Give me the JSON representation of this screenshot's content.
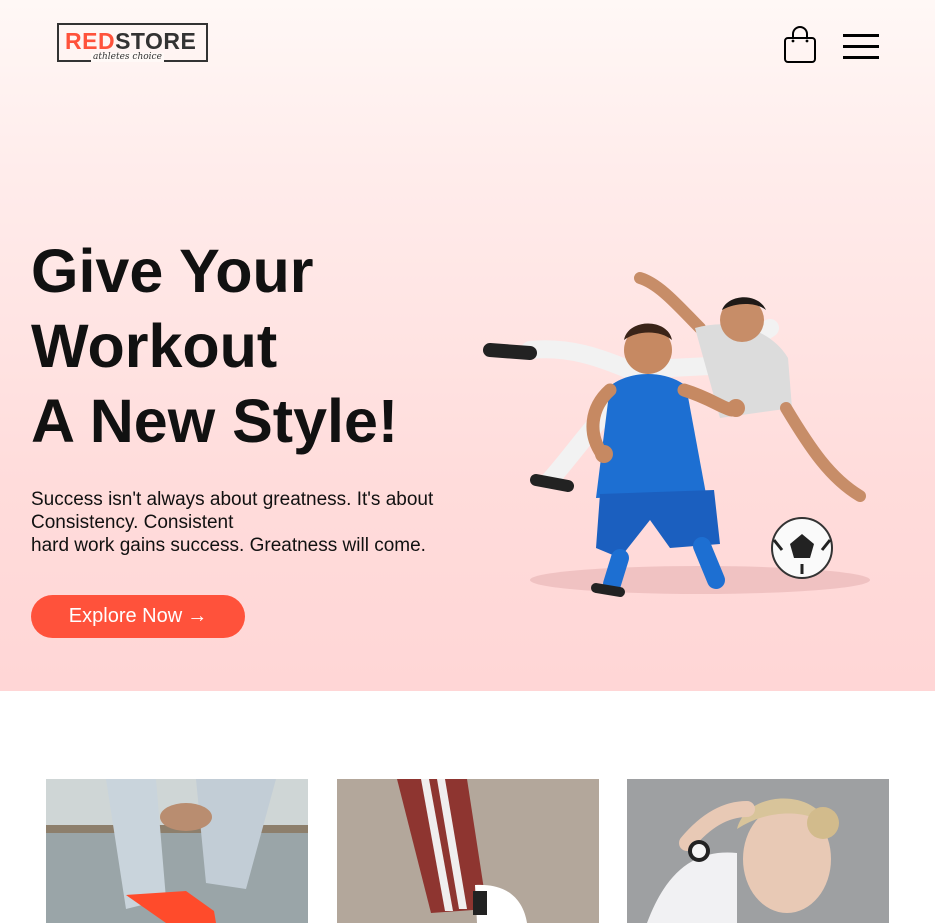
{
  "header": {
    "logo": {
      "red": "RED",
      "dark": "STORE",
      "tagline": "athletes choice"
    },
    "icons": [
      "shopping-bag-icon",
      "hamburger-menu-icon"
    ]
  },
  "hero": {
    "headline": [
      "Give Your",
      "Workout",
      "A New Style!"
    ],
    "subtext": [
      "Success isn't always about greatness. It's about",
      "Consistency. Consistent",
      "hard work gains success. Greatness will come."
    ],
    "cta_label": "Explore Now",
    "cta_arrow": "→",
    "image": "soccer-players-hero-image"
  },
  "categories": [
    {
      "image": "sneakers-jeans-photo"
    },
    {
      "image": "track-pants-shoe-photo"
    },
    {
      "image": "woman-smartwatch-photo"
    }
  ],
  "colors": {
    "accent": "#ff523b",
    "hero_bg": "#ffdcdb",
    "text": "#111111"
  }
}
